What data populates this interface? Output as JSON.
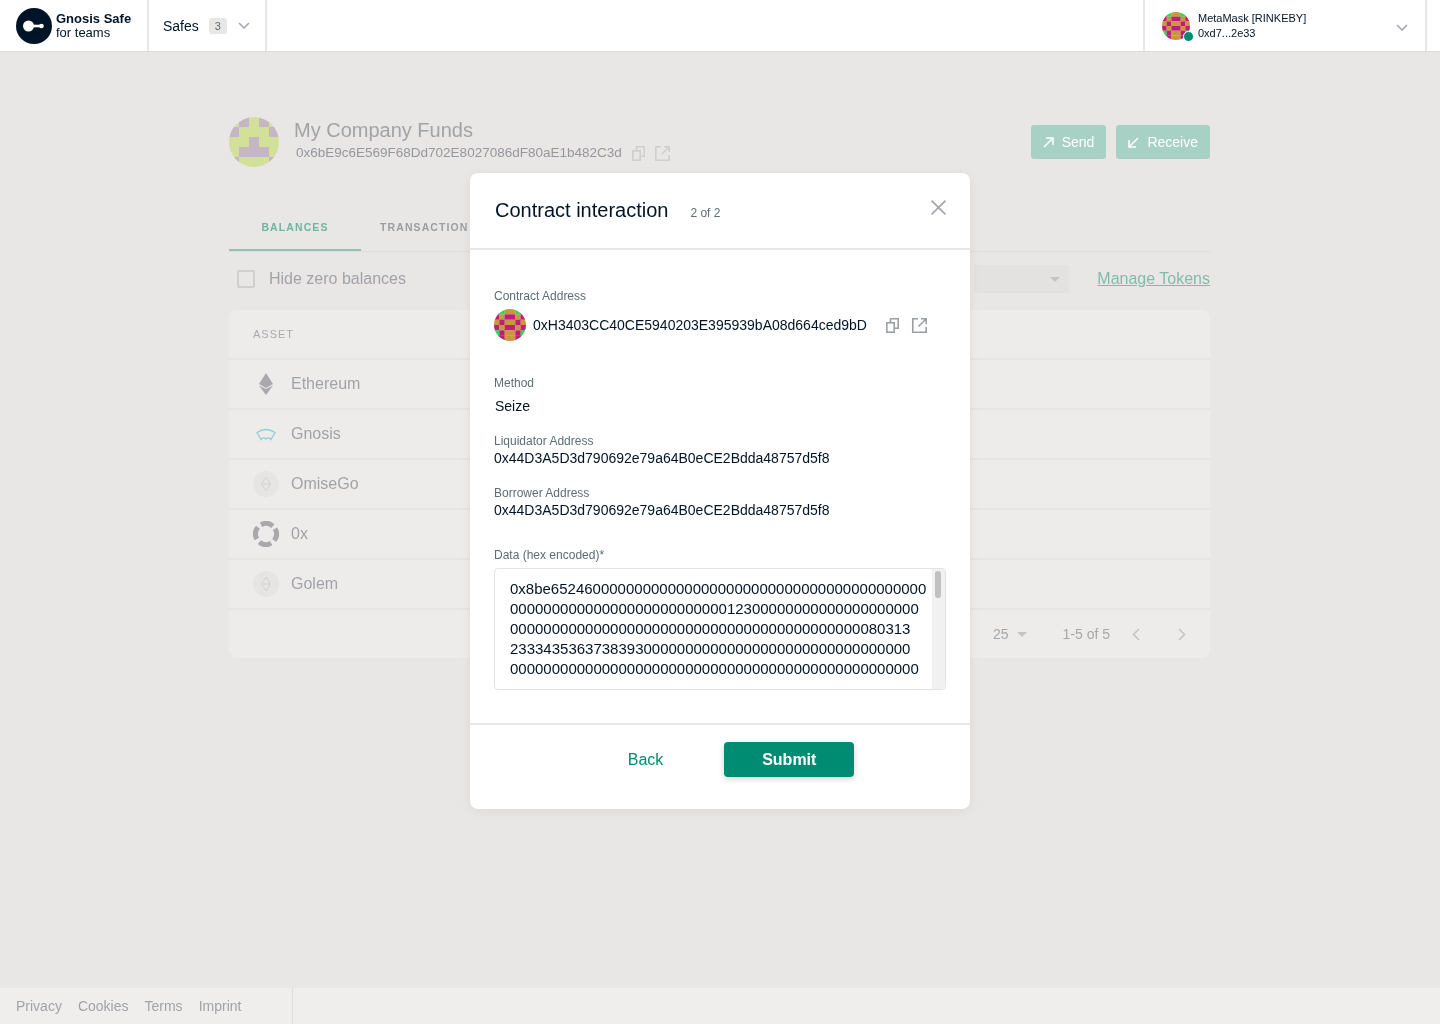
{
  "header": {
    "logo": {
      "title": "Gnosis Safe",
      "subtitle": "for teams"
    },
    "safes": {
      "label": "Safes",
      "count": "3"
    },
    "wallet": {
      "name": "MetaMask [RINKEBY]",
      "address": "0xd7...2e33",
      "connected": true
    }
  },
  "safe": {
    "name": "My Company Funds",
    "address": "0x6bE9c6E569F68Dd702E8027086dF80aE1b482C3d",
    "actions": [
      {
        "kind": "send",
        "label": "Send"
      },
      {
        "kind": "receive",
        "label": "Receive"
      }
    ]
  },
  "tabs": [
    {
      "label": "BALANCES",
      "selected": true
    },
    {
      "label": "TRANSACTION",
      "selected": false
    }
  ],
  "filters": {
    "hide_zero_balances": {
      "label": "Hide zero balances",
      "checked": false
    },
    "manage_tokens": "Manage Tokens"
  },
  "table": {
    "columns": [
      "ASSET"
    ],
    "rows": [
      {
        "kind": "diamond",
        "asset": "Ethereum"
      },
      {
        "kind": "wing",
        "asset": "Gnosis"
      },
      {
        "kind": "token",
        "asset": "OmiseGo"
      },
      {
        "kind": "ring",
        "asset": "0x"
      },
      {
        "kind": "token",
        "asset": "Golem"
      }
    ],
    "pagination": {
      "rows_per_page": "25",
      "range": "1-5 of 5"
    }
  },
  "modal": {
    "title": "Contract interaction",
    "step": "2 of 2",
    "fields": [
      {
        "kind": "address",
        "label": "Contract Address",
        "value": "0xH3403CC40CE5940203E395939bA08d664ced9bD"
      },
      {
        "kind": "method",
        "label": "Method",
        "value": "Seize"
      },
      {
        "kind": "text",
        "label": "Liquidator Address",
        "value": "0x44D3A5D3d790692e79a64B0eCE2Bdda48757d5f8"
      },
      {
        "kind": "text",
        "label": "Borrower Address",
        "value": "0x44D3A5D3d790692e79a64B0eCE2Bdda48757d5f8"
      },
      {
        "kind": "textarea",
        "label": "Data (hex encoded)*",
        "value": "0x8be65246000000000000000000000000000000000000000000000000000000000000000000123000000000000000000000000000000000000000000000000000000000000000803132333435363738393000000000000000000000000000000000000000000000000000000000000000000000000000000000"
      }
    ],
    "buttons": [
      {
        "kind": "secondary",
        "label": "Back"
      },
      {
        "kind": "primary",
        "label": "Submit"
      }
    ]
  },
  "footer": {
    "links": [
      "Privacy",
      "Cookies",
      "Terms",
      "Imprint"
    ]
  }
}
